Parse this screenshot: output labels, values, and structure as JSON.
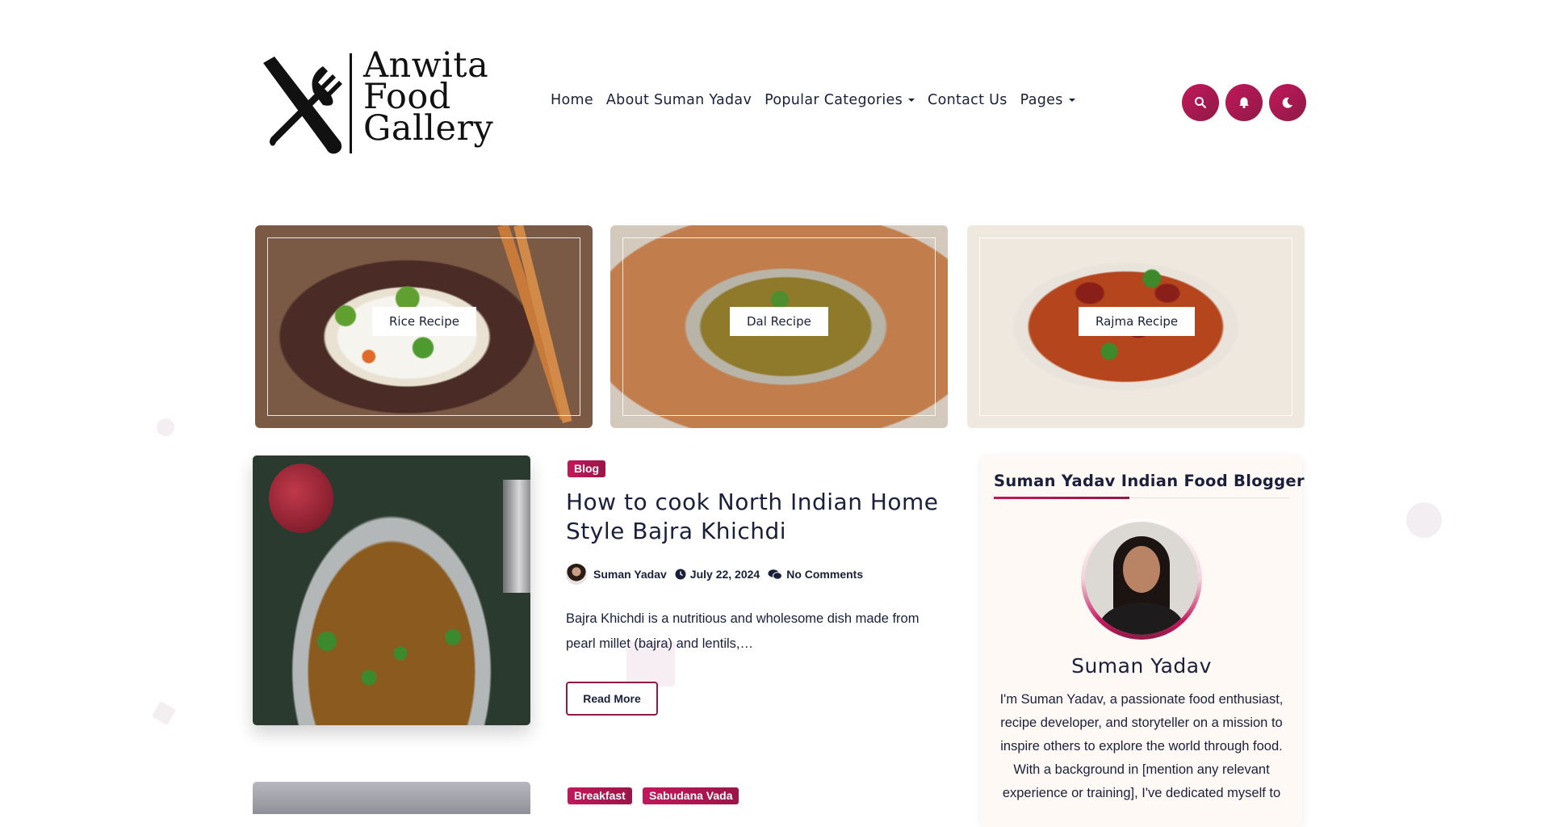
{
  "brand": {
    "logo_lines": [
      "Anwita",
      "Food",
      "Gallery"
    ]
  },
  "nav": {
    "items": [
      "Home",
      "About Suman Yadav",
      "Popular Categories",
      "Contact Us",
      "Pages"
    ]
  },
  "header_icons": [
    "search-icon",
    "bell-icon",
    "moon-icon"
  ],
  "categories": [
    {
      "label": "Rice Recipe"
    },
    {
      "label": "Dal Recipe"
    },
    {
      "label": "Rajma Recipe"
    }
  ],
  "post": {
    "tag": "Blog",
    "title": "How to cook North Indian Home Style Bajra Khichdi",
    "author": "Suman Yadav",
    "date": "July 22, 2024",
    "comments": "No Comments",
    "excerpt": "Bajra Khichdi is a nutritious and wholesome dish made from pearl millet (bajra) and lentils,…",
    "read_more": "Read More"
  },
  "post2": {
    "tags": [
      "Breakfast",
      "Sabudana Vada"
    ]
  },
  "sidebar": {
    "title": "Suman Yadav Indian Food Blogger",
    "name": "Suman Yadav",
    "bio": "I'm Suman Yadav, a passionate food enthusiast, recipe developer, and storyteller on a mission to inspire others to explore the world through food. With a background in [mention any relevant experience or training], I've dedicated myself to"
  },
  "colors": {
    "accent": "#c2185b",
    "accent_dark": "#8e1a46",
    "text": "#1a1f3c"
  }
}
